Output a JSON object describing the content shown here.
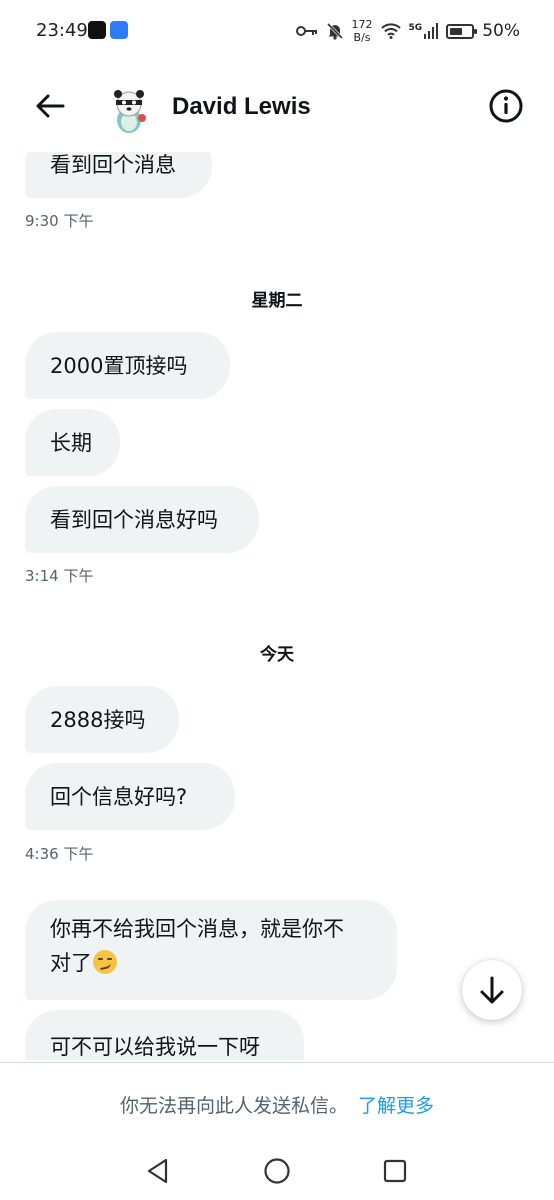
{
  "status_bar": {
    "time": "23:49",
    "net_speed_value": "172",
    "net_speed_unit": "B/s",
    "signal_label": "5G",
    "battery_percent": "50%",
    "battery_level": 0.5
  },
  "header": {
    "name": "David Lewis",
    "avatar_icon": "panda-avatar-icon",
    "back_icon": "arrow-left-icon",
    "info_icon": "info-circle-icon"
  },
  "messages": [
    {
      "text": "看到回个消息"
    },
    {
      "text": "2000置顶接吗"
    },
    {
      "text": "长期"
    },
    {
      "text": "看到回个消息好吗"
    },
    {
      "text": "2888接吗"
    },
    {
      "text": "回个信息好吗?"
    },
    {
      "text_line1": "你再不给我回个消息，就是你不",
      "text_line2": "对了"
    },
    {
      "text": "可不可以给我说一下呀"
    }
  ],
  "timestamps": [
    "9:30 下午",
    "3:14 下午",
    "4:36 下午"
  ],
  "date_separators": [
    "星期二",
    "今天"
  ],
  "notice": {
    "text": "你无法再向此人发送私信。",
    "link": "了解更多"
  },
  "colors": {
    "bubble_bg": "#eff3f4",
    "link": "#1d9bf0",
    "secondary_text": "#536471"
  }
}
